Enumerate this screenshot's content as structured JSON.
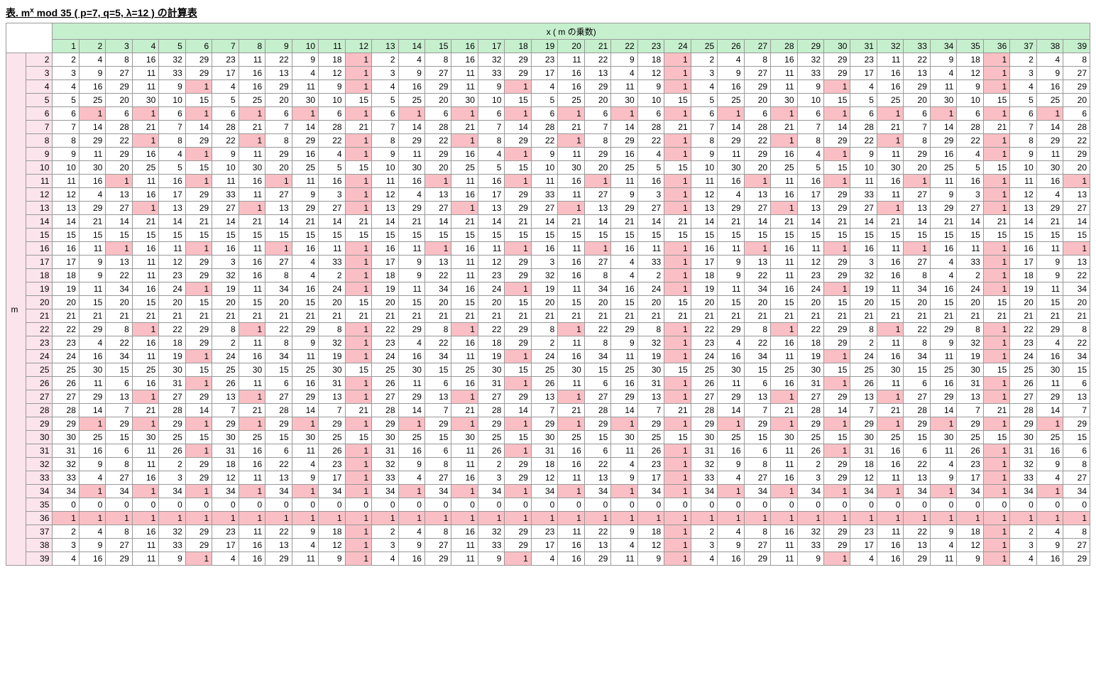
{
  "title_prefix": "表.  m",
  "title_sup": "x",
  "title_rest": " mod 35 ( p=7, q=5, λ=12 ) の計算表",
  "x_header": "x ( m の乗数)",
  "m_label": "m",
  "x_values": [
    1,
    2,
    3,
    4,
    5,
    6,
    7,
    8,
    9,
    10,
    11,
    12,
    13,
    14,
    15,
    16,
    17,
    18,
    19,
    20,
    21,
    22,
    23,
    24,
    25,
    26,
    27,
    28,
    29,
    30,
    31,
    32,
    33,
    34,
    35,
    36,
    37,
    38,
    39
  ],
  "m_values": [
    2,
    3,
    4,
    5,
    6,
    7,
    8,
    9,
    10,
    11,
    12,
    13,
    14,
    15,
    16,
    17,
    18,
    19,
    20,
    21,
    22,
    23,
    24,
    25,
    26,
    27,
    28,
    29,
    30,
    31,
    32,
    33,
    34,
    35,
    36,
    37,
    38,
    39
  ],
  "modulus": 35,
  "chart_data": {
    "type": "table",
    "title": "m^x mod 35 (p=7, q=5, λ=12) 計算表",
    "x": [
      1,
      2,
      3,
      4,
      5,
      6,
      7,
      8,
      9,
      10,
      11,
      12,
      13,
      14,
      15,
      16,
      17,
      18,
      19,
      20,
      21,
      22,
      23,
      24,
      25,
      26,
      27,
      28,
      29,
      30,
      31,
      32,
      33,
      34,
      35,
      36,
      37,
      38,
      39
    ],
    "m": [
      2,
      3,
      4,
      5,
      6,
      7,
      8,
      9,
      10,
      11,
      12,
      13,
      14,
      15,
      16,
      17,
      18,
      19,
      20,
      21,
      22,
      23,
      24,
      25,
      26,
      27,
      28,
      29,
      30,
      31,
      32,
      33,
      34,
      35,
      36,
      37,
      38,
      39
    ],
    "values_formula": "m^x mod 35",
    "highlight_rule": "cell value == 1"
  }
}
